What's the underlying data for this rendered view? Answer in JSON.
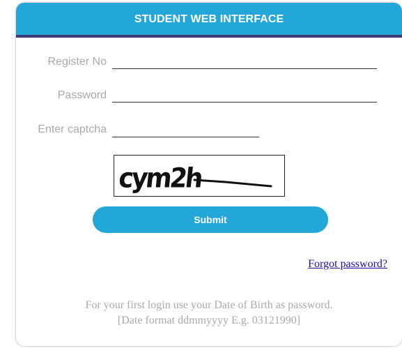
{
  "header": {
    "title": "STUDENT WEB INTERFACE"
  },
  "form": {
    "register_label": "Register No",
    "register_value": "",
    "password_label": "Password",
    "password_value": "",
    "captcha_label": "Enter captcha",
    "captcha_value": "",
    "captcha_text": "cym2h",
    "submit_label": "Submit"
  },
  "links": {
    "forgot_password": "Forgot password?"
  },
  "notes": {
    "line1": "For your first login use your Date of Birth as password.",
    "line2": "[Date format ddmmyyyy E.g. 03121990]"
  },
  "colors": {
    "header_bg": "#22a7d8",
    "header_border": "#3d3a78",
    "label_text": "#a9a9a9",
    "link": "#1a0dab",
    "button_bg": "#22a7d8"
  }
}
